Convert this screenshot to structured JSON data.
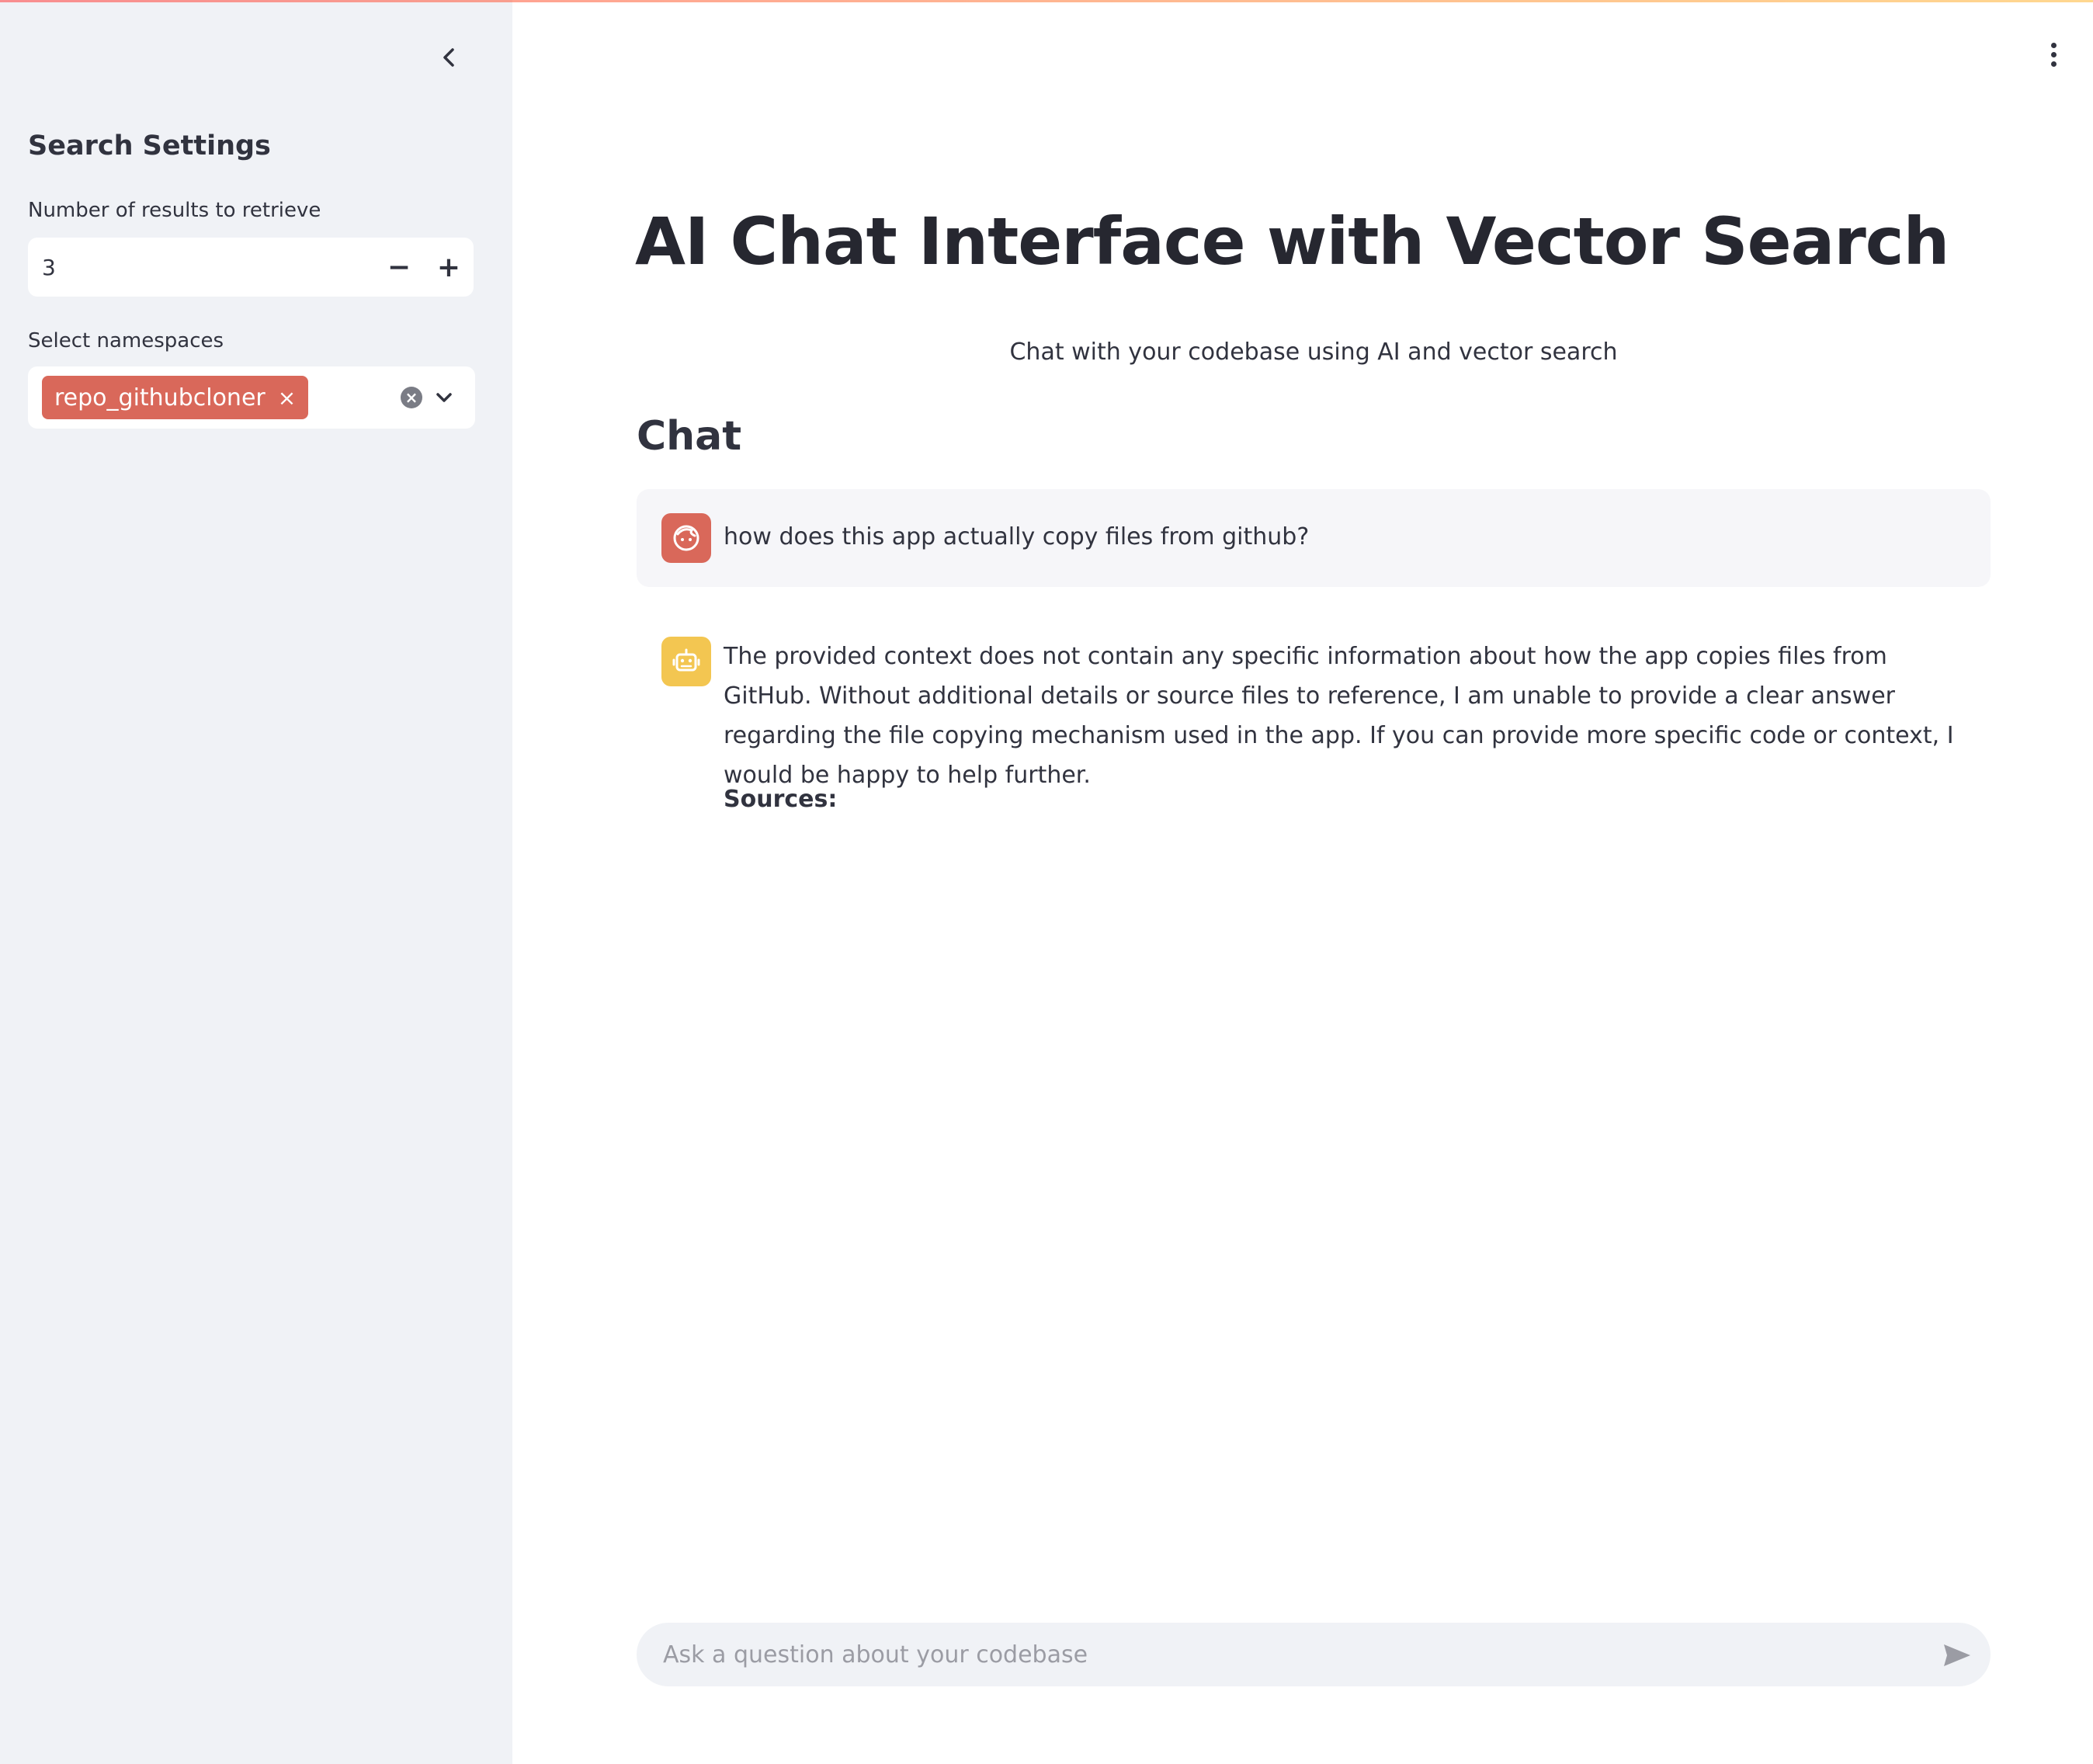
{
  "sidebar": {
    "title": "Search Settings",
    "num_results": {
      "label": "Number of results to retrieve",
      "value": "3",
      "decrement_symbol": "−",
      "increment_symbol": "+"
    },
    "namespaces": {
      "label": "Select namespaces",
      "selected": [
        "repo_githubcloner"
      ],
      "chip_remove_symbol": "×",
      "clear_symbol": "×"
    }
  },
  "main": {
    "title": "AI Chat Interface with Vector Search",
    "subtitle": "Chat with your codebase using AI and vector search",
    "chat_heading": "Chat",
    "messages": [
      {
        "role": "user",
        "avatar_icon": "user-face-icon",
        "text": "how does this app actually copy files from github?"
      },
      {
        "role": "assistant",
        "avatar_icon": "robot-icon",
        "text": "The provided context does not contain any specific information about how the app copies files from GitHub. Without additional details or source files to reference, I am unable to provide a clear answer regarding the file copying mechanism used in the app. If you can provide more specific code or context, I would be happy to help further.",
        "sources_label": "Sources:"
      }
    ],
    "chat_input": {
      "placeholder": "Ask a question about your codebase",
      "value": ""
    }
  },
  "colors": {
    "sidebar_bg": "#f0f2f6",
    "chip": "#d9685a",
    "user_avatar": "#d9685a",
    "bot_avatar": "#f3c651",
    "text": "#31333f"
  },
  "icons": {
    "collapse": "chevron-left-icon",
    "menu": "more-vertical-icon",
    "send": "send-icon",
    "dropdown": "chevron-down-icon",
    "clear": "clear-circle-icon"
  }
}
